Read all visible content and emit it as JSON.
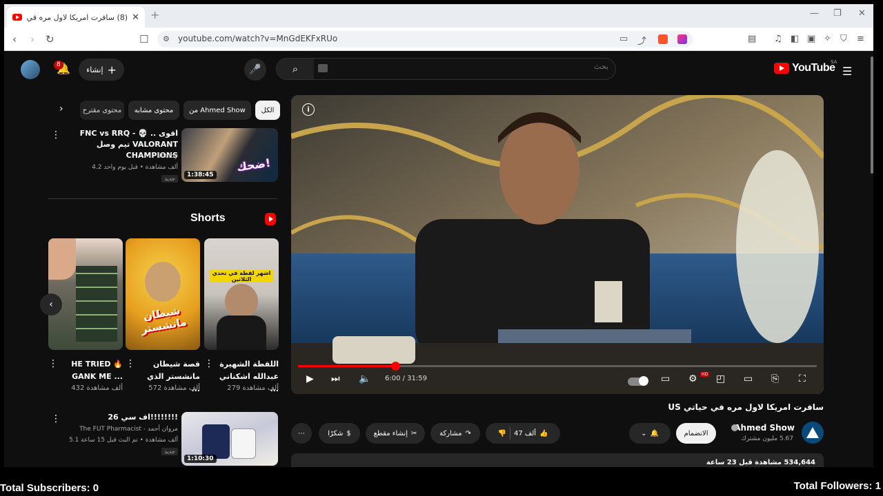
{
  "browser": {
    "tab_title": "(8) سافرت امريكا لاول مره في حياتي",
    "url": "youtube.com/watch?v=MnGdEKFxRUo",
    "new_tab_glyph": "+",
    "minimize_glyph": "—",
    "maximize_glyph": "❐",
    "close_glyph": "✕"
  },
  "header": {
    "notification_count": "8",
    "create_label": "إنشاء",
    "search_placeholder": "بحث",
    "logo_text": "YouTube",
    "country_code": "SA"
  },
  "chips": [
    {
      "label": "الكل",
      "active": true
    },
    {
      "label": "من Ahmed Show",
      "active": false
    },
    {
      "label": "محتوى مشابه",
      "active": false
    },
    {
      "label": "محتوى مقترح",
      "active": false
    }
  ],
  "recommendations": [
    {
      "title": "FNC vs RRQ - 💀 .. اقوى تيم وصل VALORANT CHAMPIONS",
      "channel": "Shelby",
      "stats": "4.2 ألف مشاهدة • قبل يوم واحد",
      "badge": "جديد",
      "duration": "1:38:45",
      "thumb_text": "ضحك!"
    },
    {
      "title": "اف سي 26!!!!!!!!",
      "channel": "مروان أحمد - The FUT Pharmacist",
      "stats": "5.1 ألف مشاهدة • تم البث قبل 15 ساعة",
      "badge": "جديد",
      "duration": "1:10:30",
      "thumb_text": ""
    }
  ],
  "shorts": {
    "title": "Shorts",
    "items": [
      {
        "title": "اللقطة الشهيرة عبدالله اشكناني ...",
        "views": "279 ألف مشاهدة",
        "thumb_text": "اشهر لقطة في تحدي الثلاثين"
      },
      {
        "title": "قصة شيطان مانشستر الذي ...",
        "views": "572 ألف مشاهدة",
        "thumb_text": "شيطان مانشستر"
      },
      {
        "title": "HE TRIED 🔥 GANK ME ...",
        "views": "432 ألف مشاهدة",
        "thumb_text": ""
      }
    ]
  },
  "player": {
    "current_time": "6:00",
    "duration": "31:59",
    "time_display": "6:00 / 31:59",
    "progress_fraction": 0.188,
    "quality_badge": "HD"
  },
  "video": {
    "title": "سافرت امريكا لاول مره في حياتي US",
    "channel_name": "Ahmed Show",
    "subscribers": "5.67 مليون مشترك",
    "subscribe_label": "الانضمام",
    "likes": "47 ألف",
    "share_label": "مشاركة",
    "clip_label": "إنشاء مقطع",
    "thanks_label": "شكرًا",
    "views_date": "534,644 مشاهدة  قبل 23 ساعة"
  },
  "overlay": {
    "subscribers_total": "Total Subscribers: 0",
    "followers_total": "Total Followers: 1"
  },
  "colors": {
    "brand_red": "#ff0000",
    "background": "#0f0f0f",
    "chip_bg": "#272727"
  }
}
